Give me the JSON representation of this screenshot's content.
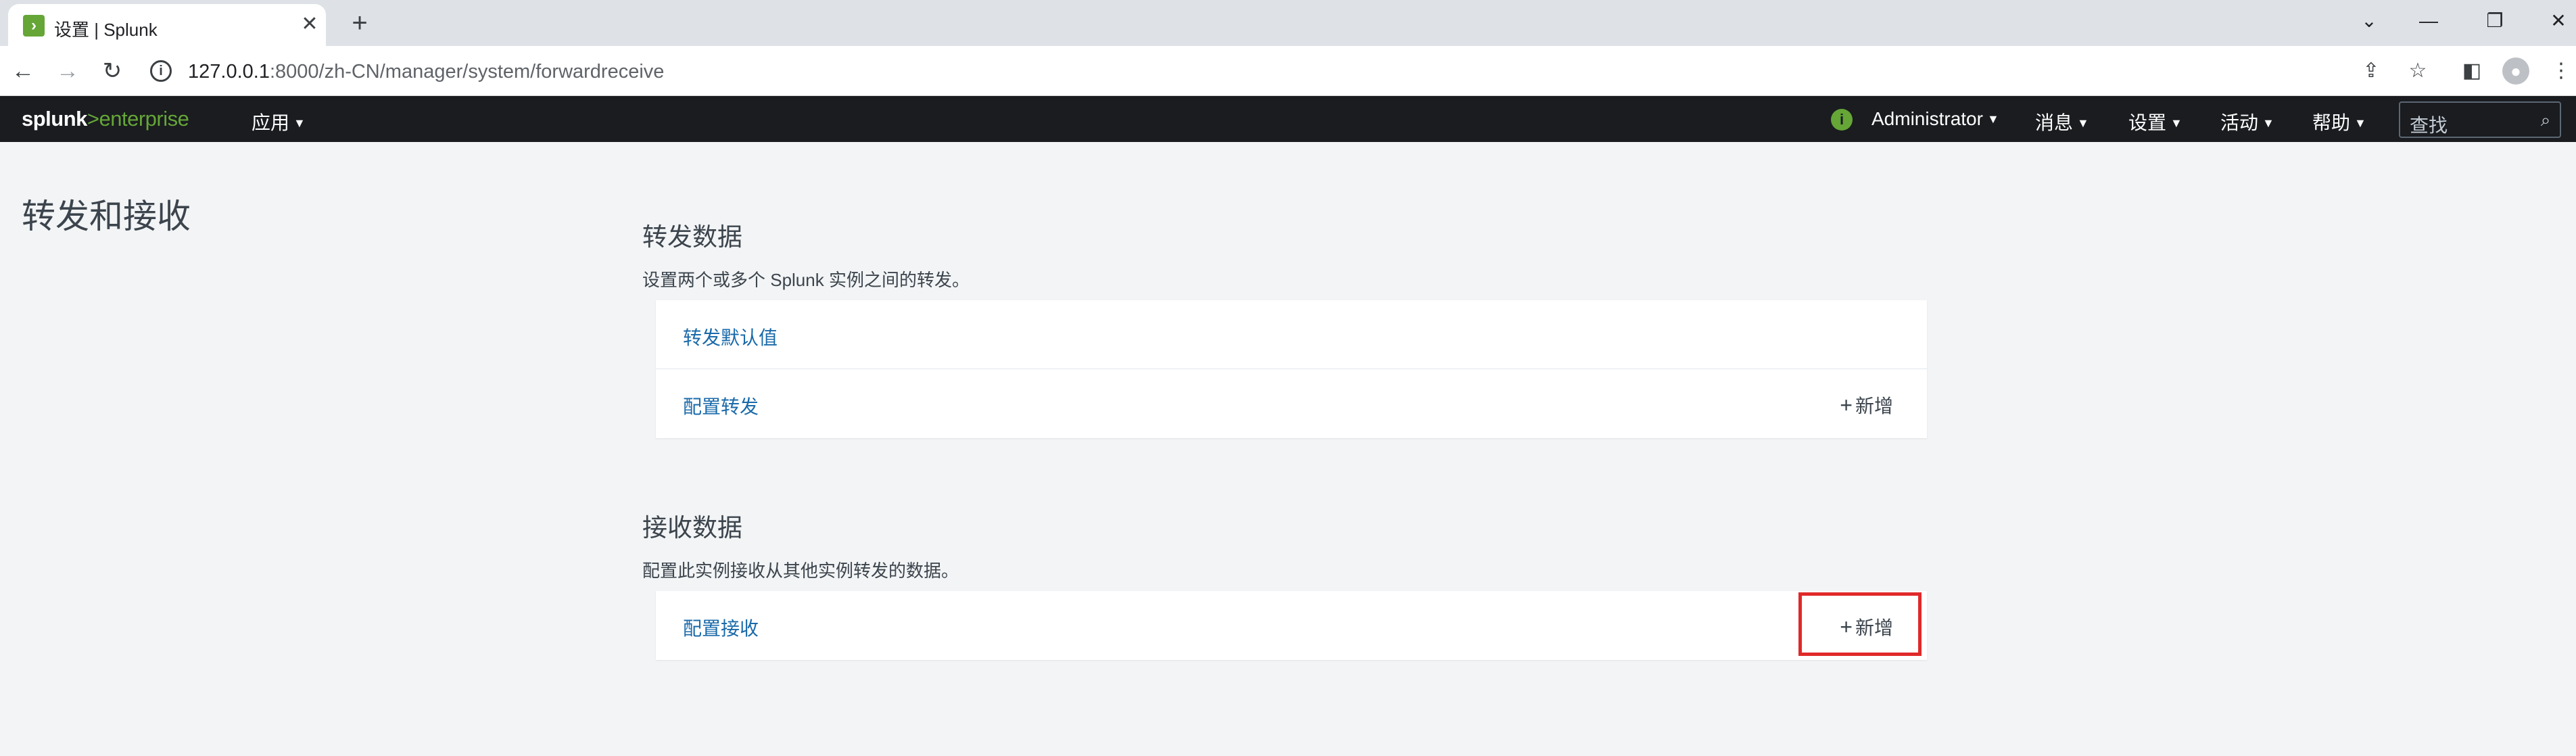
{
  "browser": {
    "tab_title": "设置 | Splunk",
    "tab_close": "✕",
    "new_tab": "+",
    "url_host": "127.0.0.1",
    "url_path": ":8000/zh-CN/manager/system/forwardreceive",
    "window_controls": [
      "⌄",
      "—",
      "❐",
      "✕"
    ]
  },
  "splunk": {
    "logo_part1": "splunk",
    "logo_part2": ">",
    "logo_part3": "enterprise",
    "app_menu": "应用",
    "user_menu": "Administrator",
    "messages_menu": "消息",
    "settings_menu": "设置",
    "activity_menu": "活动",
    "help_menu": "帮助",
    "search_placeholder": "查找"
  },
  "page": {
    "title": "转发和接收"
  },
  "forward": {
    "title": "转发数据",
    "description": "设置两个或多个 Splunk 实例之间的转发。",
    "rows": [
      {
        "label": "转发默认值"
      },
      {
        "label": "配置转发",
        "add_label": "新增"
      }
    ]
  },
  "receive": {
    "title": "接收数据",
    "description": "配置此实例接收从其他实例转发的数据。",
    "rows": [
      {
        "label": "配置接收",
        "add_label": "新增"
      }
    ]
  },
  "colors": {
    "splunk_green": "#65a637",
    "header_bg": "#1a1c20",
    "link_blue": "#1a6aaa",
    "highlight_red": "#e02929"
  },
  "icons": {
    "back": "back-arrow-icon",
    "forward": "forward-arrow-icon",
    "reload": "reload-icon",
    "info": "info-icon",
    "share": "share-icon",
    "star": "star-icon",
    "sidepanel": "side-panel-icon",
    "profile": "profile-icon",
    "menu": "kebab-menu-icon",
    "search": "search-icon"
  }
}
